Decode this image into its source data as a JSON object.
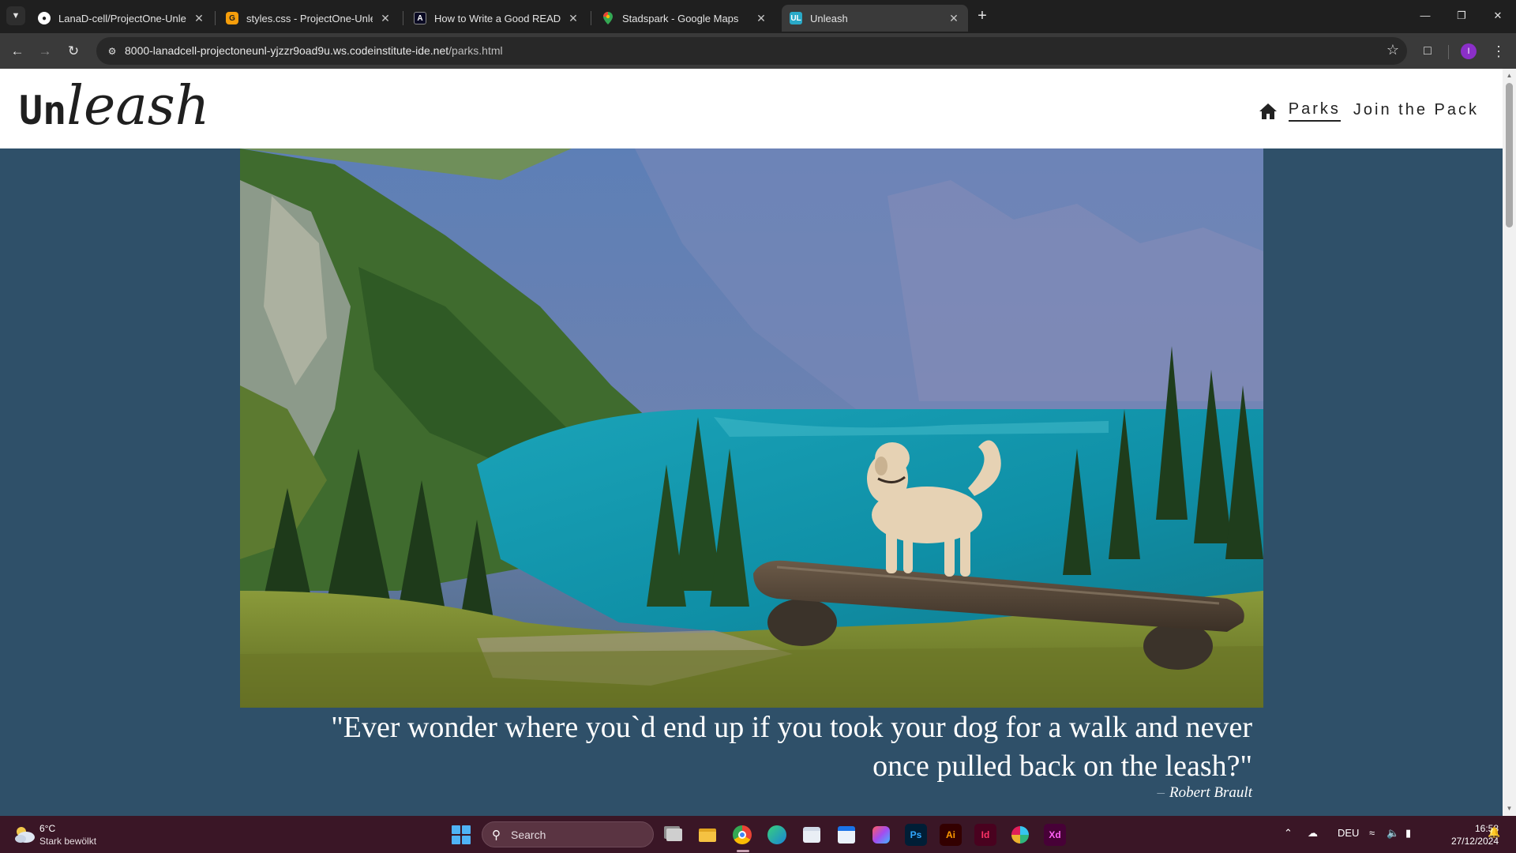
{
  "browser": {
    "tabs": [
      {
        "title": "LanaD-cell/ProjectOne-Unleash",
        "favicon": "github-icon",
        "active": false
      },
      {
        "title": "styles.css - ProjectOne-Unleash",
        "favicon": "gitpod-icon",
        "active": false
      },
      {
        "title": "How to Write a Good README",
        "favicon": "freecodecamp-icon",
        "active": false
      },
      {
        "title": "Stadspark - Google Maps",
        "favicon": "maps-pin-icon",
        "active": false
      },
      {
        "title": "Unleash",
        "favicon": "unleash-favicon",
        "favicon_text": "UL",
        "active": true
      }
    ],
    "url_host": "8000-lanadcell-projectoneunl-yjzzr9oad9u.ws.codeinstitute-ide.net",
    "url_path": "/parks.html",
    "profile_initial": "I"
  },
  "site": {
    "logo_prefix": "Un",
    "logo_suffix": "leash",
    "nav": {
      "home_icon": "home-icon",
      "links": [
        {
          "label": "Parks",
          "current": true
        },
        {
          "label": "Join the Pack",
          "current": false
        }
      ]
    },
    "hero_image_description": "dog-on-log-bench-overlooking-mountain-lake",
    "quote_line1": "\"Ever wonder where you`d end up if you took your dog for a walk and never",
    "quote_line2": "once pulled back on the leash?\"",
    "quote_dash": "–",
    "quote_author": "Robert Brault"
  },
  "taskbar": {
    "weather_temp": "6°C",
    "weather_desc": "Stark bewölkt",
    "search_label": "Search",
    "language": "DEU",
    "time": "16:58",
    "date": "27/12/2024",
    "apps": [
      {
        "name": "task-view-icon",
        "label": ""
      },
      {
        "name": "file-explorer-icon",
        "label": ""
      },
      {
        "name": "chrome-icon",
        "label": ""
      },
      {
        "name": "edge-icon",
        "label": ""
      },
      {
        "name": "store-icon",
        "label": ""
      },
      {
        "name": "calendar-icon",
        "label": ""
      },
      {
        "name": "creative-cloud-icon",
        "label": ""
      },
      {
        "name": "photoshop-icon",
        "label": "Ps"
      },
      {
        "name": "illustrator-icon",
        "label": "Ai"
      },
      {
        "name": "indesign-icon",
        "label": "Id"
      },
      {
        "name": "slack-icon",
        "label": ""
      },
      {
        "name": "xd-icon",
        "label": "Xd"
      }
    ]
  },
  "colors": {
    "page_background": "#2f5069",
    "header_background": "#ffffff",
    "taskbar": "#3a1626",
    "browser_chrome": "#1f1f1f"
  }
}
